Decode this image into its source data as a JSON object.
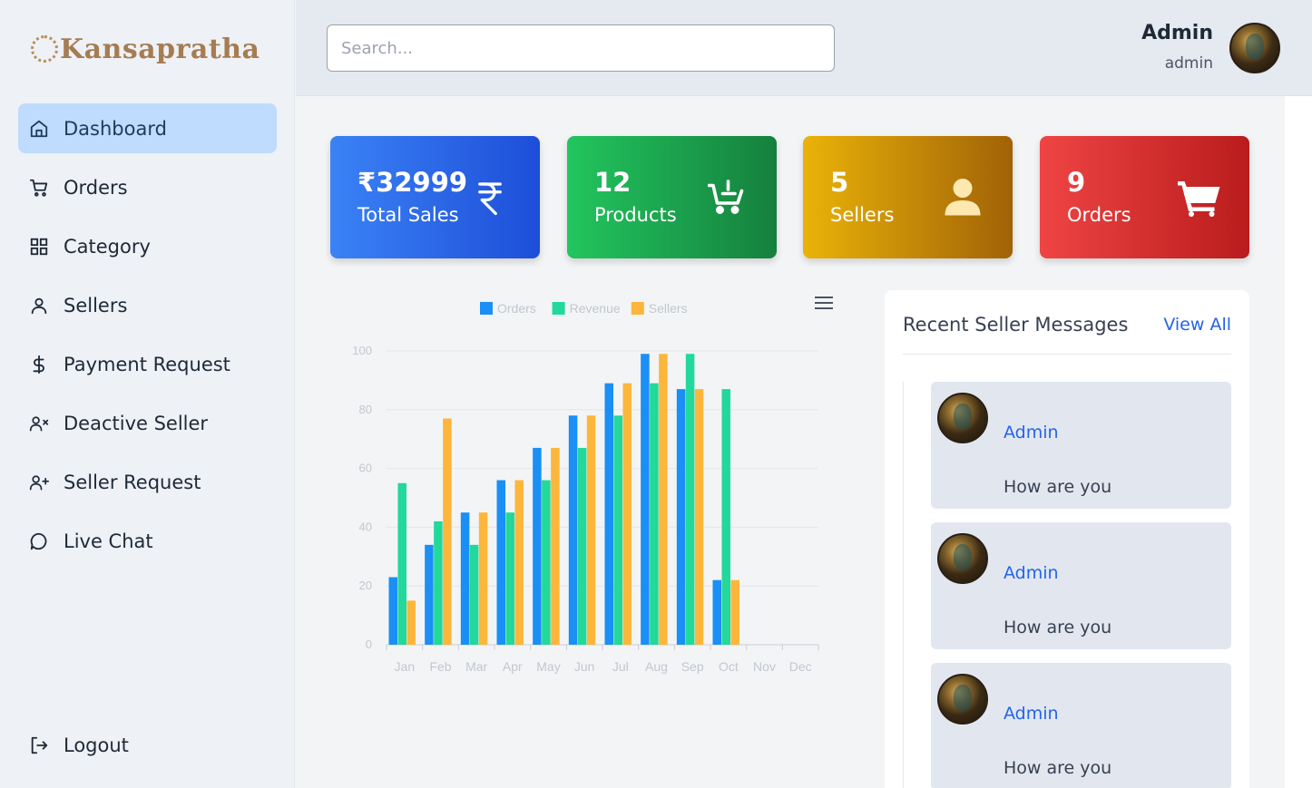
{
  "brand": {
    "name": "Kansapratha"
  },
  "sidebar": {
    "items": [
      {
        "label": "Dashboard",
        "icon": "home-icon",
        "active": true
      },
      {
        "label": "Orders",
        "icon": "cart-icon"
      },
      {
        "label": "Category",
        "icon": "grid-icon"
      },
      {
        "label": "Sellers",
        "icon": "user-icon"
      },
      {
        "label": "Payment Request",
        "icon": "dollar-icon"
      },
      {
        "label": "Deactive Seller",
        "icon": "user-x-icon"
      },
      {
        "label": "Seller Request",
        "icon": "user-plus-icon"
      },
      {
        "label": "Live Chat",
        "icon": "chat-icon"
      }
    ],
    "logout": {
      "label": "Logout",
      "icon": "logout-icon"
    }
  },
  "header": {
    "search_placeholder": "Search...",
    "user_name": "Admin",
    "user_role": "admin"
  },
  "stats": [
    {
      "value": "₹32999",
      "label": "Total Sales",
      "icon": "rupee-icon",
      "color": "#3b82f6"
    },
    {
      "value": "12",
      "label": "Products",
      "icon": "cart-add-icon",
      "color": "#22c55e"
    },
    {
      "value": "5",
      "label": "Sellers",
      "icon": "user-icon",
      "color": "#eab308"
    },
    {
      "value": "9",
      "label": "Orders",
      "icon": "cart-icon",
      "color": "#ef4444"
    }
  ],
  "chart_data": {
    "type": "bar",
    "categories": [
      "Jan",
      "Feb",
      "Mar",
      "Apr",
      "May",
      "Jun",
      "Jul",
      "Aug",
      "Sep",
      "Oct",
      "Nov",
      "Dec"
    ],
    "series": [
      {
        "name": "Orders",
        "color": "#1a8ff5",
        "values": [
          23,
          34,
          45,
          56,
          67,
          78,
          89,
          99,
          87,
          22,
          null,
          null
        ]
      },
      {
        "name": "Revenue",
        "color": "#22d89a",
        "values": [
          55,
          42,
          34,
          45,
          56,
          67,
          78,
          89,
          99,
          87,
          null,
          null
        ]
      },
      {
        "name": "Sellers",
        "color": "#fcb63b",
        "values": [
          15,
          77,
          45,
          56,
          67,
          78,
          89,
          99,
          87,
          22,
          null,
          null
        ]
      }
    ],
    "yticks": [
      "0",
      "20",
      "40",
      "60",
      "80",
      "100"
    ],
    "ylim": [
      0,
      100
    ],
    "legend_position": "top-center",
    "grid": true
  },
  "messages": {
    "title": "Recent Seller Messages",
    "view_all": "View All",
    "items": [
      {
        "name": "Admin",
        "text": "How are you"
      },
      {
        "name": "Admin",
        "text": "How are you"
      },
      {
        "name": "Admin",
        "text": "How are you"
      }
    ]
  }
}
